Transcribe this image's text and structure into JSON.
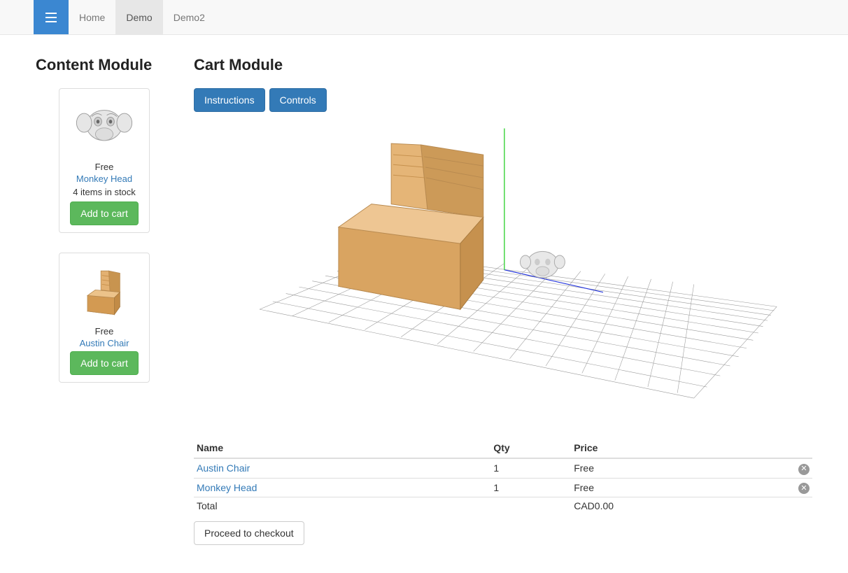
{
  "nav": {
    "items": [
      {
        "label": "Home",
        "active": false
      },
      {
        "label": "Demo",
        "active": true
      },
      {
        "label": "Demo2",
        "active": false
      }
    ]
  },
  "sidebar": {
    "title": "Content Module",
    "products": [
      {
        "price": "Free",
        "name": "Monkey Head",
        "stock": "4 items in stock",
        "add_label": "Add to cart",
        "icon": "monkey"
      },
      {
        "price": "Free",
        "name": "Austin Chair",
        "stock": "",
        "add_label": "Add to cart",
        "icon": "chair"
      }
    ]
  },
  "cart": {
    "title": "Cart Module",
    "buttons": {
      "instructions": "Instructions",
      "controls": "Controls"
    },
    "table": {
      "headers": {
        "name": "Name",
        "qty": "Qty",
        "price": "Price"
      },
      "rows": [
        {
          "name": "Austin Chair",
          "qty": "1",
          "price": "Free"
        },
        {
          "name": "Monkey Head",
          "qty": "1",
          "price": "Free"
        }
      ],
      "total_label": "Total",
      "total_value": "CAD0.00"
    },
    "checkout_label": "Proceed to checkout"
  }
}
